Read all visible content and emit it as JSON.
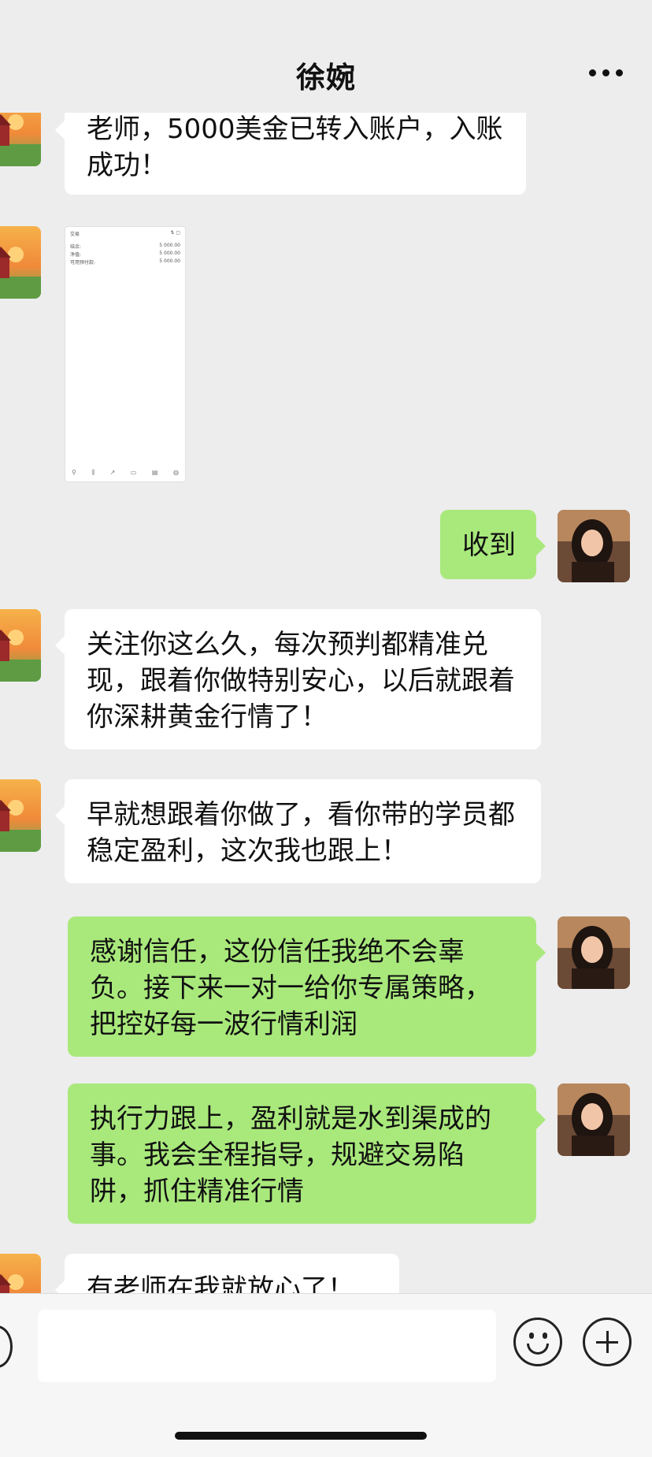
{
  "header": {
    "title": "徐婉"
  },
  "messages": [
    {
      "side": "left",
      "text": "老师，5000美金已转入账户，入账成功！"
    },
    {
      "side": "left",
      "type": "image",
      "screenshot": {
        "header_label": "交易",
        "rows": [
          {
            "label": "结余:",
            "value": "5 000.00"
          },
          {
            "label": "净值:",
            "value": "5 000.00"
          },
          {
            "label": "可用预付款:",
            "value": "5 000.00"
          }
        ]
      }
    },
    {
      "side": "right",
      "text": "收到"
    },
    {
      "side": "left",
      "text": "关注你这么久，每次预判都精准兑现，跟着你做特别安心，以后就跟着你深耕黄金行情了！"
    },
    {
      "side": "left",
      "text": "早就想跟着你做了，看你带的学员都稳定盈利，这次我也跟上！"
    },
    {
      "side": "right",
      "text": "感谢信任，这份信任我绝不会辜负。接下来一对一给你专属策略，把控好每一波行情利润"
    },
    {
      "side": "right",
      "text": "执行力跟上，盈利就是水到渠成的事。我会全程指导，规避交易陷阱，抓住精准行情"
    },
    {
      "side": "left",
      "text": "有老师在我就放心了！"
    }
  ],
  "input": {
    "value": ""
  },
  "colors": {
    "background": "#ededed",
    "bubble_self": "#a9e97c",
    "bubble_other": "#ffffff"
  },
  "icons": {
    "more": "more-dots-icon",
    "voice": "voice-icon",
    "emoji": "emoji-icon",
    "plus": "plus-icon"
  }
}
